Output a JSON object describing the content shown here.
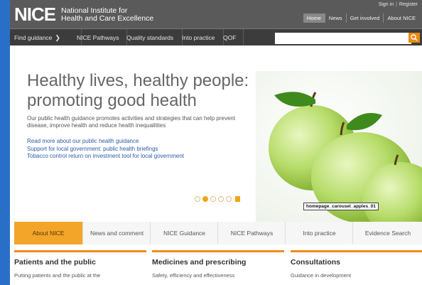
{
  "header": {
    "logo": "NICE",
    "logo_line1": "National Institute for",
    "logo_line2": "Health and Care Excellence",
    "sign_in": "Sign in",
    "register": "Register",
    "top_nav": [
      "Home",
      "News",
      "Get involved",
      "About NICE"
    ]
  },
  "navbar": {
    "find_guidance": "Find guidance",
    "pathways": "NICE Pathways",
    "quality": "Quality standards",
    "into_practice": "Into practice",
    "qof": "QOF",
    "search_placeholder": "",
    "search_icon": "search-icon"
  },
  "hero": {
    "title": "Healthy lives, healthy people: promoting good health",
    "body": "Our public health guidance promotes activities and strategies that can help prevent disease, improve health and reduce health inequalitites",
    "links": [
      "Read more about our public health guidance",
      "Support for local government: public health briefings",
      "Tobacco control return on investment tool for local government"
    ],
    "image_caption": "homepage_carousel_apples_01"
  },
  "tabs": [
    {
      "label": "About NICE"
    },
    {
      "label": "News and comment"
    },
    {
      "label": "NICE Guidance"
    },
    {
      "label": "NICE Pathways"
    },
    {
      "label": "Into practice"
    },
    {
      "label": "Evidence Search"
    }
  ],
  "columns": [
    {
      "title": "Patients and the public",
      "sub": "Putting patients and the public at the"
    },
    {
      "title": "Medicines and prescribing",
      "sub": "Safety, efficiency and effectiveness"
    },
    {
      "title": "Consultations",
      "sub": "Guidance in development"
    }
  ],
  "colors": {
    "accent": "#f3a52a",
    "nav": "#3c3c3c",
    "header": "#5a5a5a",
    "link": "#2c5aa8"
  }
}
